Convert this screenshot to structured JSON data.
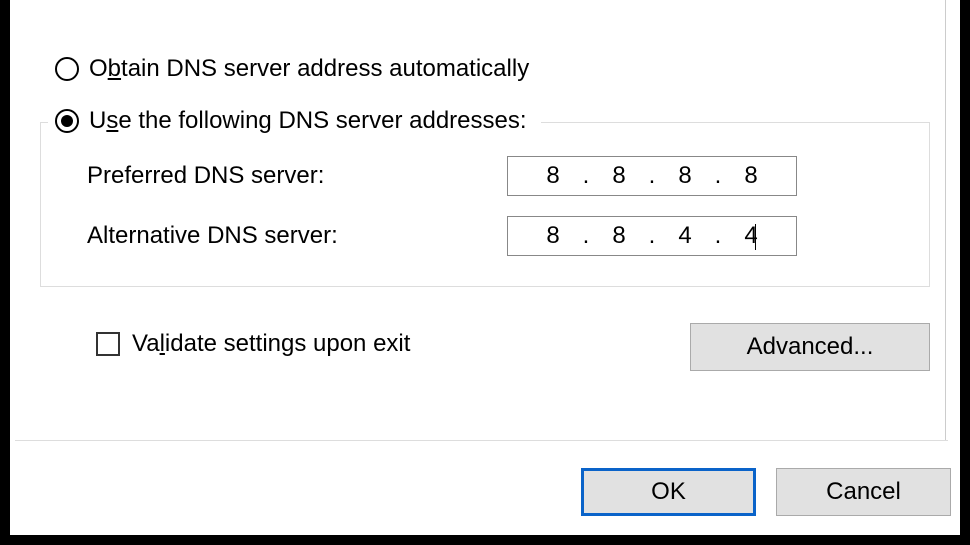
{
  "radios": {
    "auto": {
      "label_pre": "O",
      "label_ul": "b",
      "label_post": "tain DNS server address automatically",
      "selected": false
    },
    "manual": {
      "label_pre": "U",
      "label_ul": "s",
      "label_post": "e the following DNS server addresses:",
      "selected": true
    }
  },
  "dns": {
    "preferred": {
      "label_ul": "P",
      "label_post": "referred DNS server:",
      "octets": [
        "8",
        "8",
        "8",
        "8"
      ]
    },
    "alternative": {
      "label_ul": "A",
      "label_post": "lternative DNS server:",
      "octets": [
        "8",
        "8",
        "4",
        "4"
      ]
    }
  },
  "validate": {
    "label_pre": "Va",
    "label_ul": "l",
    "label_post": "idate settings upon exit",
    "checked": false
  },
  "buttons": {
    "advanced_pre": "Ad",
    "advanced_ul": "v",
    "advanced_post": "anced...",
    "ok": "OK",
    "cancel": "Cancel"
  }
}
